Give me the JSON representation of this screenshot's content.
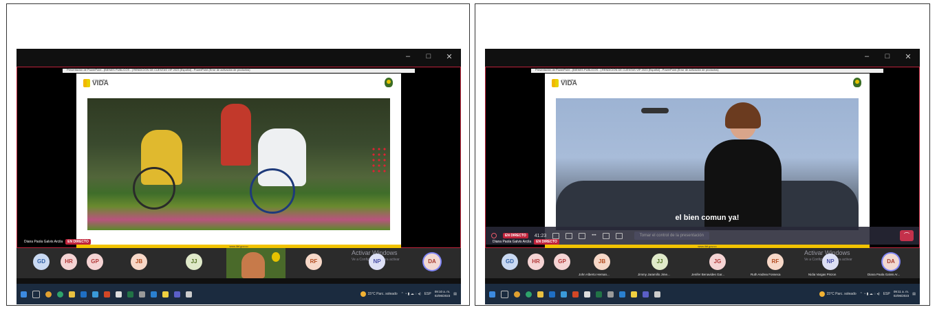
{
  "window_controls": [
    "–",
    "□",
    "✕"
  ],
  "left": {
    "pp_title": "Presentación de PowerPoint - [BIENES PÚBLICOS - ] RENDICIÓN DE CUENTAS VIP 2023 [Español] - PowerPoint (Error de activación de productos)",
    "slide": {
      "brand_top": "COLOMBIA",
      "brand": "VIDA",
      "footer_url": "www.ilbf.gov.co"
    },
    "presenter_name": "Diana Paola Galvis Arcila",
    "live_label": "EN DIRECTO",
    "participants": [
      {
        "initials": "GD",
        "bg": "#c9d9f2",
        "fg": "#3060a6"
      },
      {
        "initials": "HR",
        "bg": "#f5d4d4",
        "fg": "#b23838"
      },
      {
        "initials": "GP",
        "bg": "#f5d4d4",
        "fg": "#b23838"
      },
      {
        "initials": "JB",
        "bg": "#f7d8c8",
        "fg": "#b24a1e"
      },
      {
        "initials": "JJ",
        "bg": "#dfe9c9",
        "fg": "#4e6e1c"
      },
      {
        "initials": "RF",
        "bg": "#f7d8c8",
        "fg": "#b24a1e"
      },
      {
        "initials": "NP",
        "bg": "#dde0f5",
        "fg": "#4a50a6"
      },
      {
        "initials": "DA",
        "bg": "#f2d9d2",
        "fg": "#a63a2e"
      }
    ],
    "activate_title": "Activar Windows",
    "activate_sub": "Ve a Configuración para activar",
    "weather": "15°C  Parc. soleado",
    "lang": "ESP",
    "time": "09:10 a. m.",
    "date": "02/06/2023"
  },
  "right": {
    "pp_title": "Presentación de PowerPoint - [BIENES PÚBLICOS - ] RENDICIÓN DE CUENTAS VIP 2023 [Español] - PowerPoint (Error de activación de productos)",
    "slide": {
      "brand_top": "COLOMBIA",
      "brand": "VIDA",
      "footer_url": "www.ilbf.gov.co"
    },
    "caption": "el bien comun ya!",
    "toolbar": {
      "live": "EN DIRECTO",
      "counter": "41:23",
      "take_control": "Tomar el control de la presentación"
    },
    "presenter_name": "Diana Paola Galvis Arcila",
    "live_label": "EN DIRECTO",
    "participants": [
      {
        "initials": "GD",
        "bg": "#c9d9f2",
        "fg": "#3060a6",
        "name": ""
      },
      {
        "initials": "HR",
        "bg": "#f5d4d4",
        "fg": "#b23838",
        "name": ""
      },
      {
        "initials": "GP",
        "bg": "#f5d4d4",
        "fg": "#b23838",
        "name": ""
      },
      {
        "initials": "JB",
        "bg": "#f7d8c8",
        "fg": "#b24a1e",
        "name": "John Alberto Hernan..."
      },
      {
        "initials": "JJ",
        "bg": "#dfe9c9",
        "fg": "#4e6e1c",
        "name": "Jimmy Jaramillo Jime..."
      },
      {
        "initials": "JG",
        "bg": "#f5d4d4",
        "fg": "#b23838",
        "name": "Jenifer Benavides Gar..."
      },
      {
        "initials": "RF",
        "bg": "#f7d8c8",
        "fg": "#b24a1e",
        "name": "Ruth Andrea Fonseca"
      },
      {
        "initials": "NP",
        "bg": "#dde0f5",
        "fg": "#4a50a6",
        "name": "Nidia Vargas Pinzon"
      },
      {
        "initials": "DA",
        "bg": "#f2d9d2",
        "fg": "#a63a2e",
        "name": "Diana Paola Galvis Ar..."
      }
    ],
    "activate_title": "Activar Windows",
    "activate_sub": "Ve a Configuración para activar",
    "weather": "15°C  Parc. soleado",
    "lang": "ESP",
    "time": "09:11 a. m.",
    "date": "02/06/2023"
  }
}
